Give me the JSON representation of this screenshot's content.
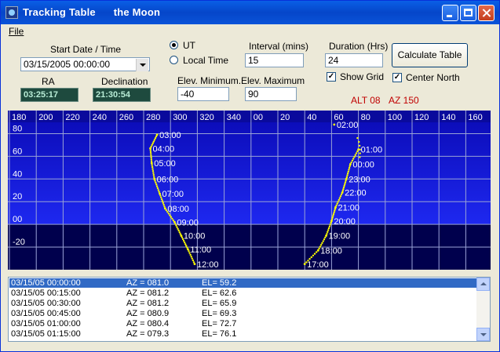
{
  "window": {
    "title": "Tracking Table      the Moon"
  },
  "menu": {
    "file": "File"
  },
  "form": {
    "start_label": "Start Date / Time",
    "start_value": "03/15/2005  00:00:00",
    "ra_label": "RA",
    "ra_value": "03:25:17",
    "dec_label": "Declination",
    "dec_value": "21:30:54",
    "ut_label": "UT",
    "local_label": "Local Time",
    "interval_label": "Interval (mins)",
    "interval_value": "15",
    "duration_label": "Duration (Hrs)",
    "duration_value": "24",
    "calc_label": "Calculate Table",
    "show_grid_label": "Show Grid",
    "center_north_label": "Center North",
    "elev_min_label": "Elev. Minimum.",
    "elev_min_value": "-40",
    "elev_max_label": "Elev. Maximum",
    "elev_max_value": "90",
    "alt_text": "ALT 08",
    "az_text": "AZ 150",
    "ut_selected": true,
    "show_grid_checked": true,
    "center_north_checked": true
  },
  "chart_data": {
    "type": "scatter",
    "x_tick_labels": [
      "180",
      "200",
      "220",
      "240",
      "260",
      "280",
      "300",
      "320",
      "340",
      "00",
      "20",
      "40",
      "60",
      "80",
      "100",
      "120",
      "140",
      "160"
    ],
    "y_tick_labels": [
      "80",
      "60",
      "40",
      "20",
      "00",
      "-20"
    ],
    "ylim": [
      -40,
      90
    ],
    "grid": true,
    "colors": {
      "above_horizon_top": "#0a0ab4",
      "above_horizon_bottom": "#1e28f0",
      "below_horizon": "#00004d",
      "trace": "#ffff00",
      "grid": "#9aa3d6"
    },
    "points": [
      {
        "label": "00:00",
        "az": 81.0,
        "el": 59.2
      },
      {
        "label": "00:15",
        "az": 81.2,
        "el": 62.6
      },
      {
        "label": "00:30",
        "az": 81.2,
        "el": 65.9
      },
      {
        "label": "00:45",
        "az": 80.9,
        "el": 69.3
      },
      {
        "label": "01:00",
        "az": 80.4,
        "el": 72.7
      },
      {
        "label": "01:15",
        "az": 79.3,
        "el": 76.1
      },
      {
        "label": "02:00",
        "az": 62,
        "el": 88
      },
      {
        "label": "03:00",
        "az": 290,
        "el": 79
      },
      {
        "label": "04:00",
        "az": 285,
        "el": 67
      },
      {
        "label": "05:00",
        "az": 286,
        "el": 54
      },
      {
        "label": "06:00",
        "az": 288,
        "el": 40
      },
      {
        "label": "07:00",
        "az": 292,
        "el": 27
      },
      {
        "label": "08:00",
        "az": 296,
        "el": 14
      },
      {
        "label": "09:00",
        "az": 303,
        "el": 2
      },
      {
        "label": "10:00",
        "az": 308,
        "el": -10
      },
      {
        "label": "11:00",
        "az": 313,
        "el": -22
      },
      {
        "label": "12:00",
        "az": 318,
        "el": -35
      },
      {
        "label": "17:00",
        "az": 40,
        "el": -35
      },
      {
        "label": "18:00",
        "az": 50,
        "el": -23
      },
      {
        "label": "19:00",
        "az": 56,
        "el": -10
      },
      {
        "label": "20:00",
        "az": 60,
        "el": 3
      },
      {
        "label": "21:00",
        "az": 63,
        "el": 15
      },
      {
        "label": "22:00",
        "az": 68,
        "el": 28
      },
      {
        "label": "23:00",
        "az": 71,
        "el": 40
      },
      {
        "label": "00:00",
        "az": 74,
        "el": 53
      },
      {
        "label": "01:00",
        "az": 80,
        "el": 66
      }
    ]
  },
  "table": {
    "rows": [
      {
        "date": "03/15/05  00:00:00",
        "az": "AZ = 081.0",
        "el": "EL= 59.2"
      },
      {
        "date": "03/15/05  00:15:00",
        "az": "AZ = 081.2",
        "el": "EL= 62.6"
      },
      {
        "date": "03/15/05  00:30:00",
        "az": "AZ = 081.2",
        "el": "EL= 65.9"
      },
      {
        "date": "03/15/05  00:45:00",
        "az": "AZ = 080.9",
        "el": "EL= 69.3"
      },
      {
        "date": "03/15/05  01:00:00",
        "az": "AZ = 080.4",
        "el": "EL= 72.7"
      },
      {
        "date": "03/15/05  01:15:00",
        "az": "AZ = 079.3",
        "el": "EL= 76.1"
      }
    ]
  }
}
